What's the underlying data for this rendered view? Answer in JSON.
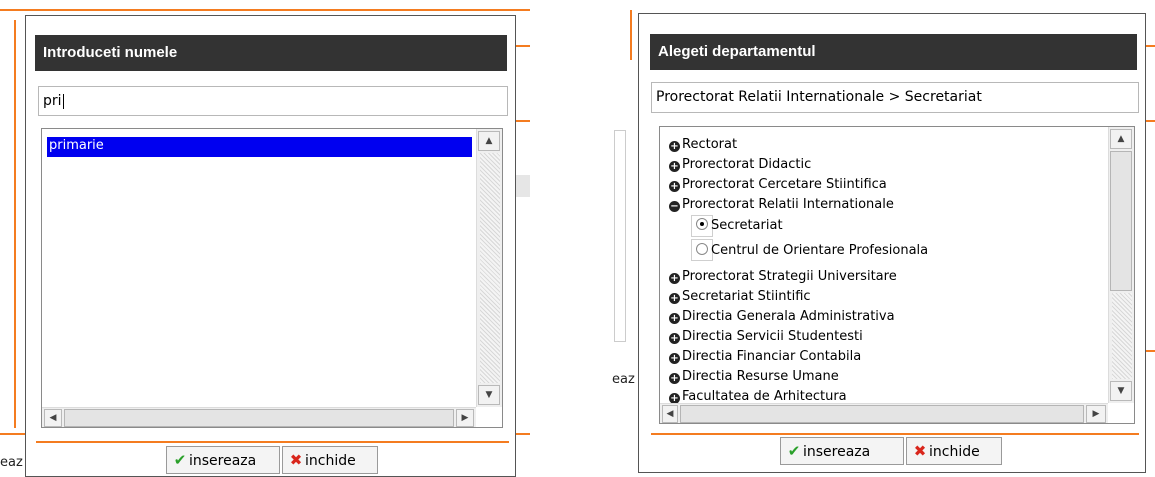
{
  "left_dialog": {
    "title": "Introduceti numele",
    "search_value": "pri",
    "results": [
      "primarie"
    ],
    "buttons": {
      "insert_label": "insereaza",
      "close_label": "inchide"
    }
  },
  "right_dialog": {
    "title": "Alegeti departamentul",
    "selected_path": "Prorectorat Relatii Internationale > Secretariat",
    "tree": [
      {
        "label": "Rectorat",
        "state": "collapsed"
      },
      {
        "label": "Prorectorat Didactic",
        "state": "collapsed"
      },
      {
        "label": "Prorectorat Cercetare Stiintifica",
        "state": "collapsed"
      },
      {
        "label": "Prorectorat Relatii Internationale",
        "state": "expanded"
      },
      {
        "label": "Secretariat",
        "state": "radio-selected"
      },
      {
        "label": "Centrul de Orientare Profesionala",
        "state": "radio"
      },
      {
        "label": "Prorectorat Strategii Universitare",
        "state": "collapsed"
      },
      {
        "label": "Secretariat Stiintific",
        "state": "collapsed"
      },
      {
        "label": "Directia Generala Administrativa",
        "state": "collapsed"
      },
      {
        "label": "Directia Servicii Studentesti",
        "state": "collapsed"
      },
      {
        "label": "Directia Financiar Contabila",
        "state": "collapsed"
      },
      {
        "label": "Directia Resurse Umane",
        "state": "collapsed"
      },
      {
        "label": "Facultatea de Arhitectura",
        "state": "collapsed"
      }
    ],
    "buttons": {
      "insert_label": "insereaza",
      "close_label": "inchide"
    }
  },
  "background": {
    "left_fragment": "eaz",
    "right_fragment": "eaz"
  },
  "colors": {
    "accent": "#f47c20",
    "title_bar": "#333333",
    "selection": "#0000f0",
    "check": "#2aa02a",
    "close": "#d9261c"
  },
  "icons": {
    "insert": "check-icon",
    "close": "x-icon",
    "expand": "plus-circle-icon",
    "collapse": "minus-circle-icon"
  }
}
